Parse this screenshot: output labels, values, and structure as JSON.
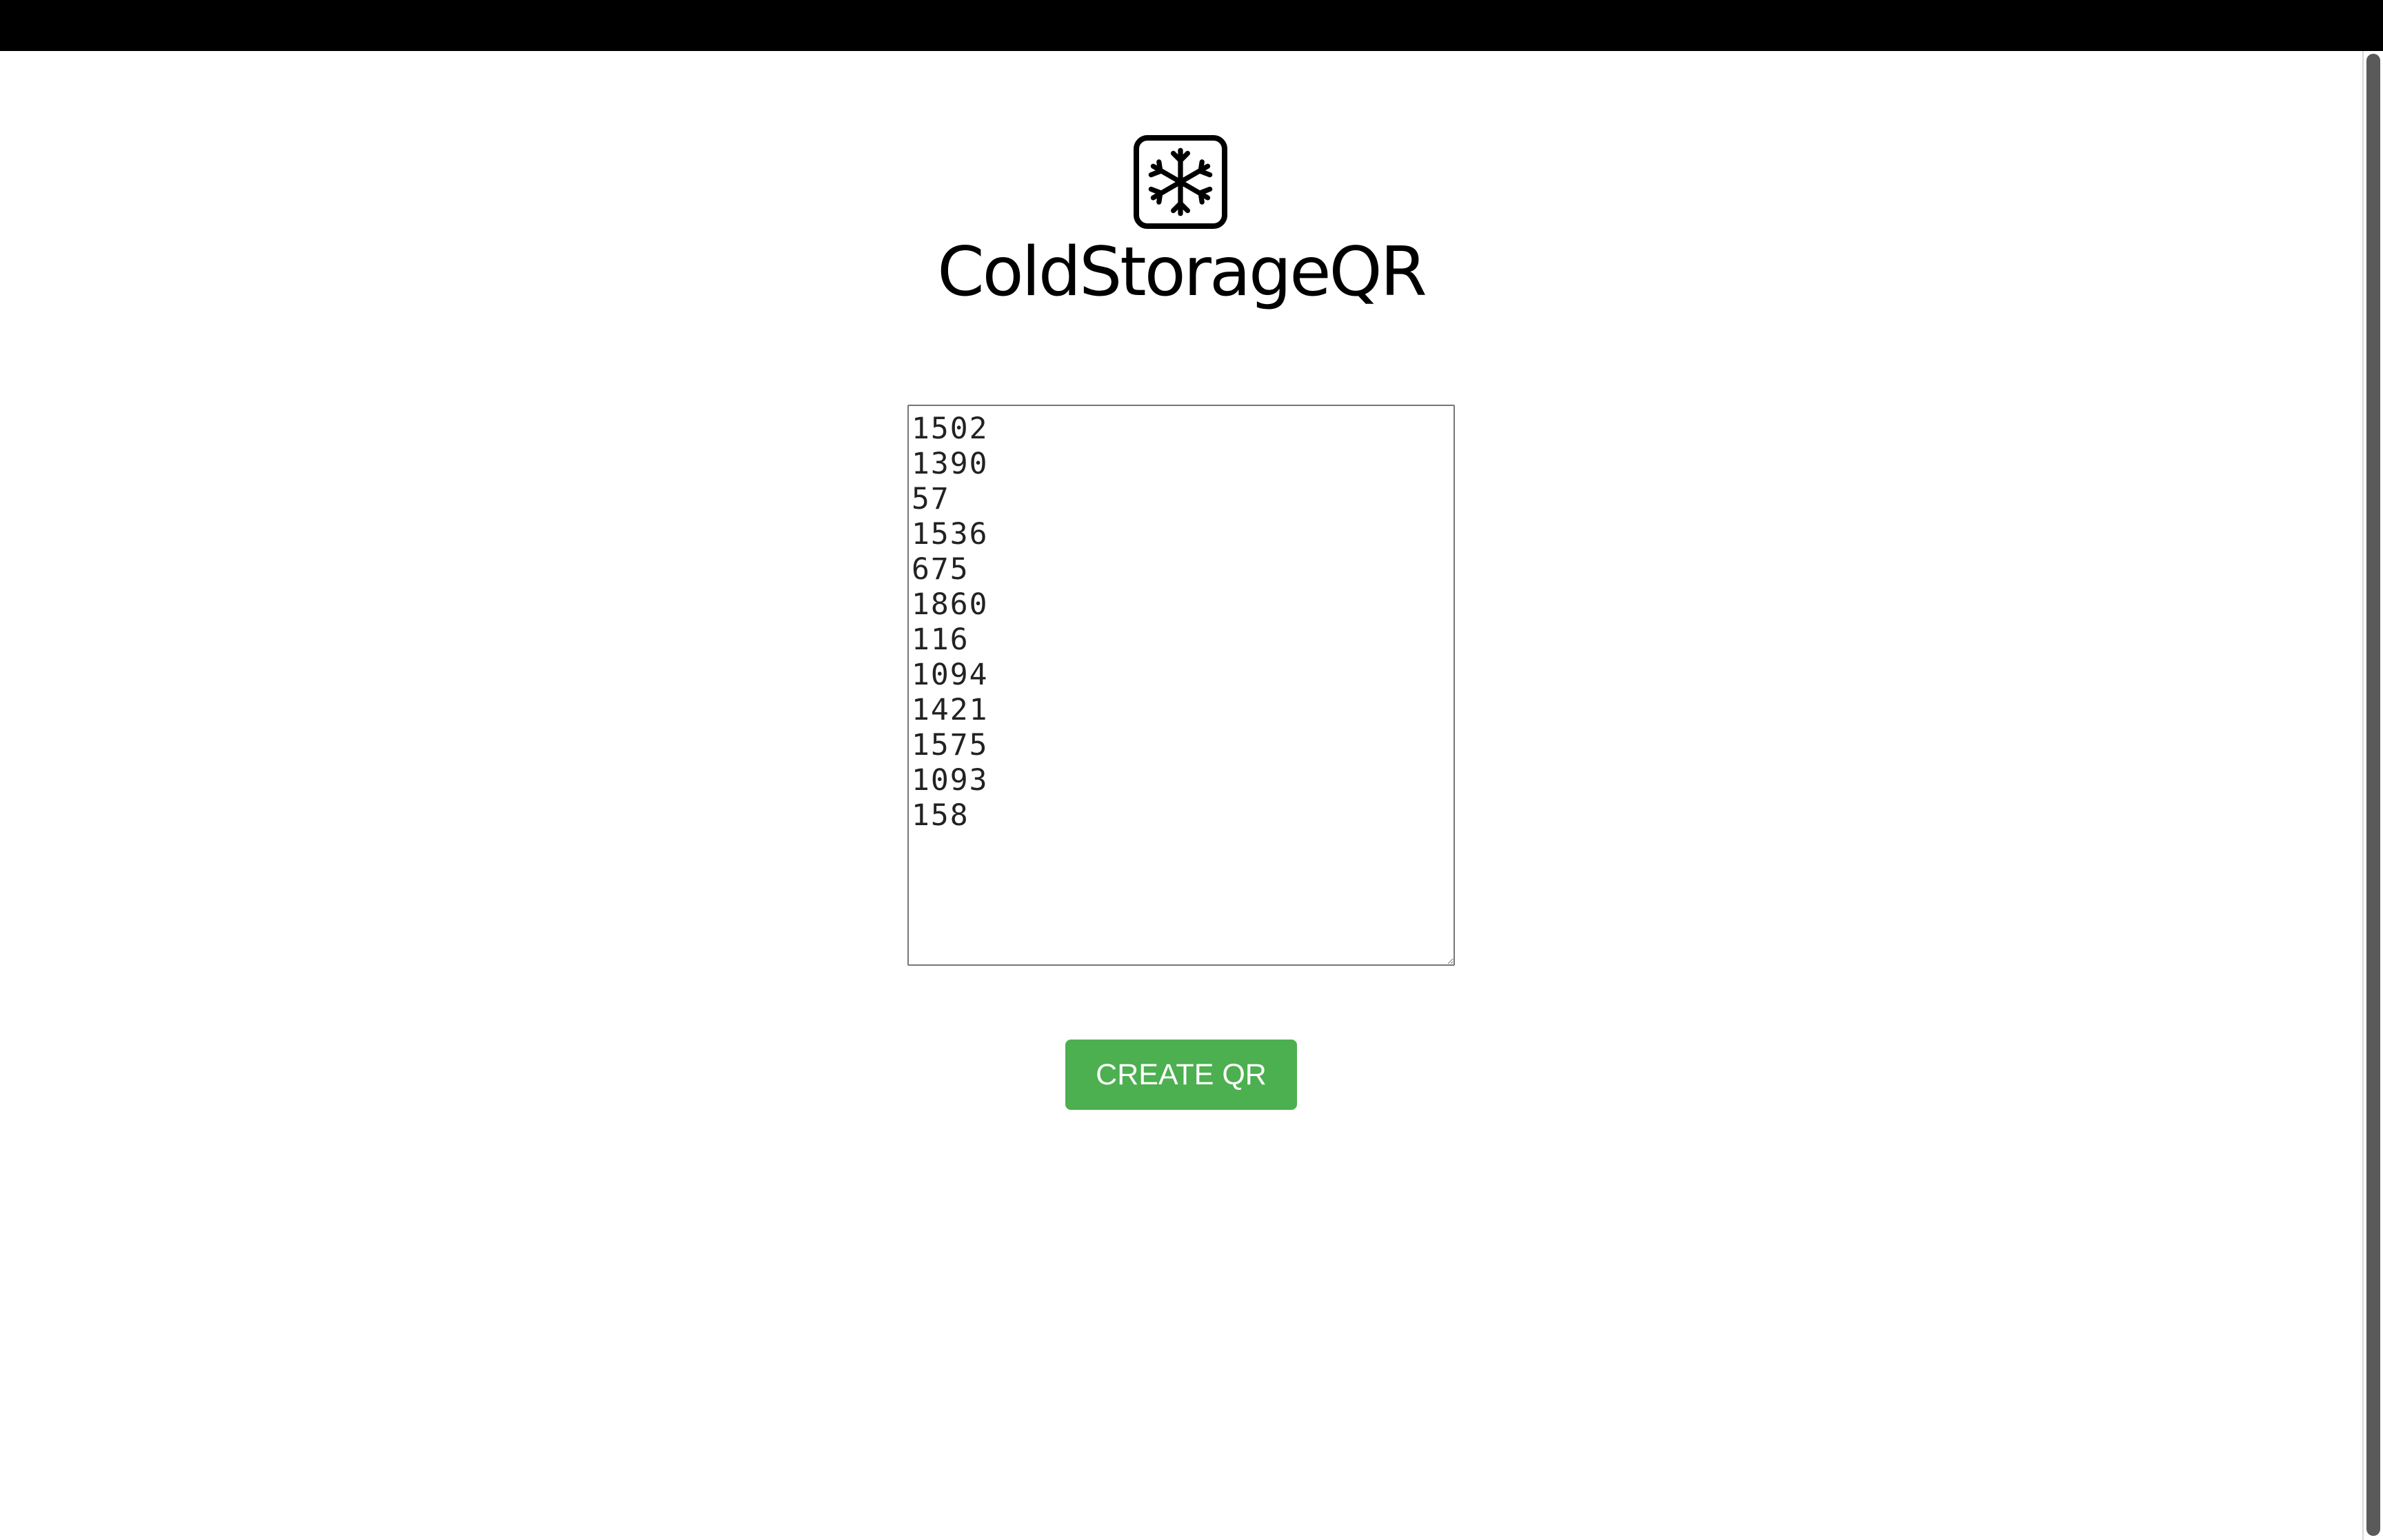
{
  "app": {
    "title": "ColdStorageQR",
    "logo_icon": "snowflake-icon"
  },
  "form": {
    "ids_text": "1502\n1390\n57\n1536\n675\n1860\n116\n1094\n1421\n1575\n1093\n158",
    "create_button_label": "CREATE QR"
  },
  "colors": {
    "button_background": "#4caf50",
    "button_text": "#ffffff",
    "top_bar": "#000000",
    "text": "#000000"
  }
}
